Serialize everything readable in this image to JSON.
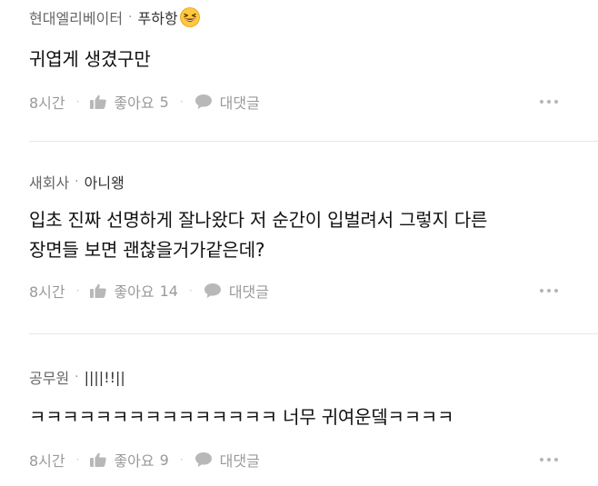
{
  "comments": [
    {
      "author": "현대엘리베이터",
      "nickname": "푸하항",
      "emoji": "grinning-squinting-face",
      "text_lines": [
        "귀엽게 생겼구만"
      ],
      "time": "8시간",
      "like_label": "좋아요",
      "like_count": "5",
      "reply_label": "대댓글"
    },
    {
      "author": "새회사",
      "nickname": "아니왱",
      "text_lines": [
        "입초 진짜 선명하게 잘나왔다 저 순간이 입벌려서 그렇지 다른",
        "장면들 보면 괜찮을거가같은데?"
      ],
      "time": "8시간",
      "like_label": "좋아요",
      "like_count": "14",
      "reply_label": "대댓글"
    },
    {
      "author": "공무원",
      "nickname": "||||!!||",
      "text_lines": [
        "ㅋㅋㅋㅋㅋㅋㅋㅋㅋㅋㅋㅋㅋㅋㅋ 너무 귀여운뎈ㅋㅋㅋㅋ"
      ],
      "time": "8시간",
      "like_label": "좋아요",
      "like_count": "9",
      "reply_label": "대댓글"
    }
  ],
  "separator": "·",
  "colors": {
    "text": "#111111",
    "meta": "#666666",
    "muted": "#9a9a9a",
    "divider": "#e6e6e6"
  },
  "icons": [
    "thumbs-up-icon",
    "speech-bubble-icon",
    "more-options-icon"
  ]
}
